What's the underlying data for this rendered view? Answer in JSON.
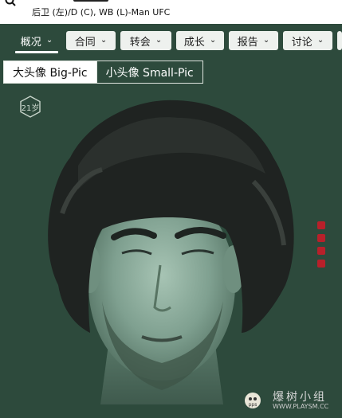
{
  "header": {
    "positions": "后卫 (左)/D (C), WB (L)-Man UFC"
  },
  "nav": {
    "tabs": [
      {
        "label": "概况",
        "active": true
      },
      {
        "label": "合同",
        "active": false
      },
      {
        "label": "转会",
        "active": false
      },
      {
        "label": "成长",
        "active": false
      },
      {
        "label": "报告",
        "active": false
      },
      {
        "label": "讨论",
        "active": false
      },
      {
        "label": "",
        "active": false
      }
    ]
  },
  "view_toggle": {
    "big": "大头像 Big-Pic",
    "small": "小头像 Small-Pic",
    "selected": "big"
  },
  "portrait": {
    "age_badge": "21岁"
  },
  "side_markers": {
    "count": 4,
    "color": "#b8202a"
  },
  "watermark": {
    "mascot_text": "pps",
    "text": "爆树小组",
    "url": "WWW.PLAYSM.CC"
  },
  "colors": {
    "background": "#2d4a3c",
    "tab_bg": "#eef1ee",
    "marker": "#b8202a"
  }
}
